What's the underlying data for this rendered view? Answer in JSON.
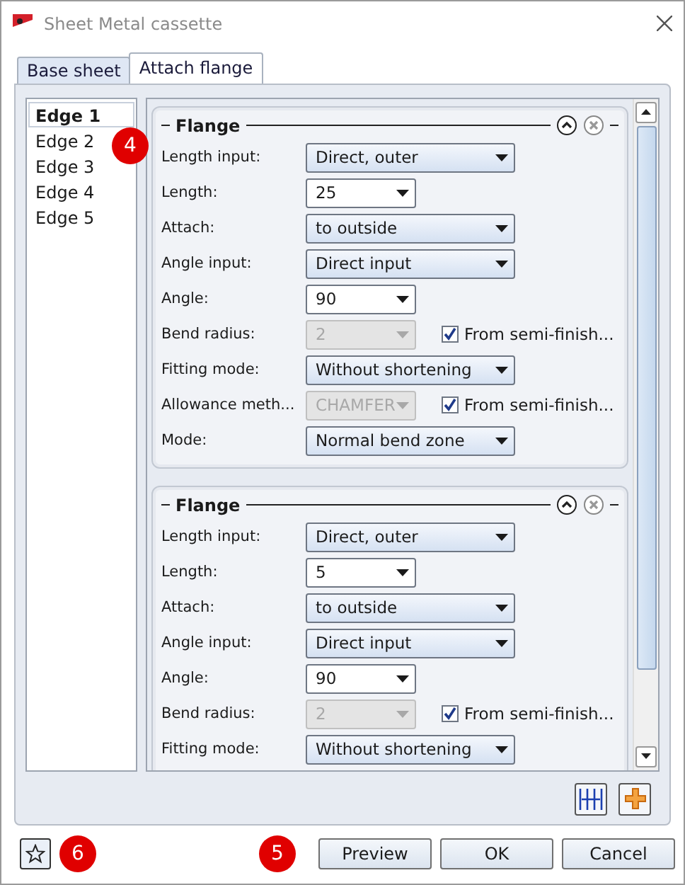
{
  "window": {
    "title": "Sheet Metal cassette"
  },
  "tabs": [
    {
      "label": "Base sheet",
      "selected": false
    },
    {
      "label": "Attach flange",
      "selected": true
    }
  ],
  "edges": [
    {
      "label": "Edge 1",
      "selected": true
    },
    {
      "label": "Edge 2",
      "selected": false
    },
    {
      "label": "Edge 3",
      "selected": false
    },
    {
      "label": "Edge 4",
      "selected": false
    },
    {
      "label": "Edge 5",
      "selected": false
    }
  ],
  "flanges": [
    {
      "title": "Flange",
      "rows": [
        {
          "label": "Length input:",
          "value": "Direct, outer",
          "kind": "wide",
          "disabled": false
        },
        {
          "label": "Length:",
          "value": "25",
          "kind": "narrow",
          "disabled": false
        },
        {
          "label": "Attach:",
          "value": "to outside",
          "kind": "wide",
          "disabled": false
        },
        {
          "label": "Angle input:",
          "value": "Direct input",
          "kind": "wide",
          "disabled": false
        },
        {
          "label": "Angle:",
          "value": "90",
          "kind": "narrow",
          "disabled": false
        },
        {
          "label": "Bend radius:",
          "value": "2",
          "kind": "narrow",
          "disabled": true,
          "checkbox": {
            "label": "From semi-finish...",
            "checked": true
          }
        },
        {
          "label": "Fitting mode:",
          "value": "Without shortening",
          "kind": "wide",
          "disabled": false
        },
        {
          "label": "Allowance meth...",
          "value": "CHAMFER",
          "kind": "narrow",
          "disabled": true,
          "checkbox": {
            "label": "From semi-finish...",
            "checked": true
          }
        },
        {
          "label": "Mode:",
          "value": "Normal bend zone",
          "kind": "wide",
          "disabled": false
        }
      ]
    },
    {
      "title": "Flange",
      "rows": [
        {
          "label": "Length input:",
          "value": "Direct, outer",
          "kind": "wide",
          "disabled": false
        },
        {
          "label": "Length:",
          "value": "5",
          "kind": "narrow",
          "disabled": false
        },
        {
          "label": "Attach:",
          "value": "to outside",
          "kind": "wide",
          "disabled": false
        },
        {
          "label": "Angle input:",
          "value": "Direct input",
          "kind": "wide",
          "disabled": false
        },
        {
          "label": "Angle:",
          "value": "90",
          "kind": "narrow",
          "disabled": false
        },
        {
          "label": "Bend radius:",
          "value": "2",
          "kind": "narrow",
          "disabled": true,
          "checkbox": {
            "label": "From semi-finish...",
            "checked": true
          }
        },
        {
          "label": "Fitting mode:",
          "value": "Without shortening",
          "kind": "wide",
          "disabled": false
        }
      ]
    }
  ],
  "buttons": [
    "Preview",
    "OK",
    "Cancel"
  ],
  "callouts": [
    "4",
    "5",
    "6"
  ]
}
